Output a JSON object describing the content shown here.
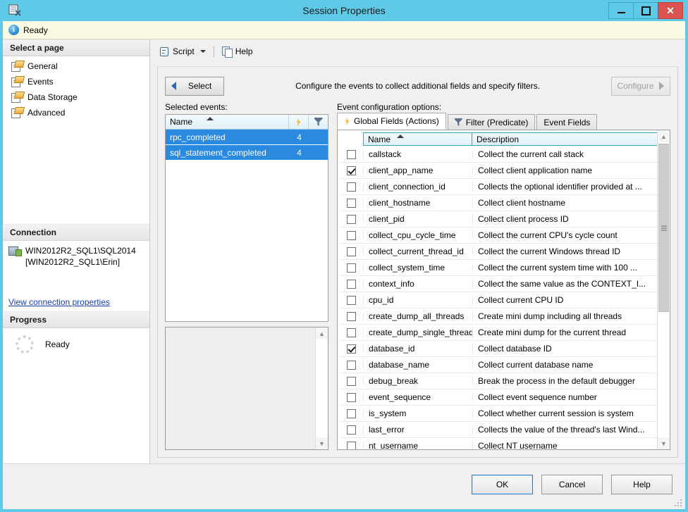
{
  "window": {
    "title": "Session Properties",
    "icon": "session-properties-icon",
    "minimize_label": "Minimize",
    "maximize_label": "Maximize",
    "close_label": "Close"
  },
  "status": {
    "icon": "info-icon",
    "text": "Ready"
  },
  "sidebar": {
    "header": "Select a page",
    "items": [
      {
        "label": "General",
        "icon": "page-icon"
      },
      {
        "label": "Events",
        "icon": "page-icon"
      },
      {
        "label": "Data Storage",
        "icon": "page-icon"
      },
      {
        "label": "Advanced",
        "icon": "page-icon"
      }
    ],
    "connection": {
      "header": "Connection",
      "icon": "server-icon",
      "server": "WIN2012R2_SQL1\\SQL2014",
      "user": "[WIN2012R2_SQL1\\Erin]",
      "link": "View connection properties"
    },
    "progress": {
      "header": "Progress",
      "icon": "spinner-icon",
      "text": "Ready"
    }
  },
  "toolbar": {
    "script_label": "Script",
    "script_icon": "script-icon",
    "script_dropdown_icon": "chevron-down-icon",
    "help_label": "Help",
    "help_icon": "help-icon"
  },
  "main": {
    "select_button": "Select",
    "select_arrow_icon": "arrow-left-icon",
    "hint": "Configure the events to collect additional fields and specify filters.",
    "configure_button": "Configure",
    "configure_arrow_icon": "arrow-right-icon",
    "configure_enabled": false,
    "selected_events_label": "Selected events:",
    "selected_events_grid": {
      "columns": [
        "Name",
        "actions-column",
        "filter-column"
      ],
      "name_header": "Name",
      "sort": "ascending",
      "action_icon": "lightning-bolt-icon",
      "filter_icon": "funnel-icon",
      "rows": [
        {
          "name": "rpc_completed",
          "actions": "4",
          "filter": "",
          "selected": true
        },
        {
          "name": "sql_statement_completed",
          "actions": "4",
          "filter": "",
          "selected": true
        }
      ]
    },
    "description_panel": {
      "text": ""
    },
    "event_config_label": "Event configuration options:",
    "tabs": [
      {
        "label": "Global Fields (Actions)",
        "icon": "lightning-bolt-icon",
        "active": true
      },
      {
        "label": "Filter (Predicate)",
        "icon": "funnel-icon",
        "active": false
      },
      {
        "label": "Event Fields",
        "icon": "",
        "active": false
      }
    ],
    "fields_table": {
      "headers": {
        "check": "",
        "name": "Name",
        "description": "Description"
      },
      "sort": "ascending",
      "rows": [
        {
          "checked": false,
          "name": "callstack",
          "description": "Collect the current call stack"
        },
        {
          "checked": true,
          "name": "client_app_name",
          "description": "Collect client application name"
        },
        {
          "checked": false,
          "name": "client_connection_id",
          "description": "Collects the optional identifier provided at ..."
        },
        {
          "checked": false,
          "name": "client_hostname",
          "description": "Collect client hostname"
        },
        {
          "checked": false,
          "name": "client_pid",
          "description": "Collect client process ID"
        },
        {
          "checked": false,
          "name": "collect_cpu_cycle_time",
          "description": "Collect the current CPU's cycle count"
        },
        {
          "checked": false,
          "name": "collect_current_thread_id",
          "description": "Collect the current Windows thread ID"
        },
        {
          "checked": false,
          "name": "collect_system_time",
          "description": "Collect the current system time with 100 ..."
        },
        {
          "checked": false,
          "name": "context_info",
          "description": "Collect the same value as the CONTEXT_I..."
        },
        {
          "checked": false,
          "name": "cpu_id",
          "description": "Collect current CPU ID"
        },
        {
          "checked": false,
          "name": "create_dump_all_threads",
          "description": "Create mini dump including all threads"
        },
        {
          "checked": false,
          "name": "create_dump_single_thread",
          "description": "Create mini dump for the current thread"
        },
        {
          "checked": true,
          "name": "database_id",
          "description": "Collect database ID"
        },
        {
          "checked": false,
          "name": "database_name",
          "description": "Collect current database name"
        },
        {
          "checked": false,
          "name": "debug_break",
          "description": "Break the process in the default debugger"
        },
        {
          "checked": false,
          "name": "event_sequence",
          "description": "Collect event sequence number"
        },
        {
          "checked": false,
          "name": "is_system",
          "description": "Collect whether current session is system"
        },
        {
          "checked": false,
          "name": "last_error",
          "description": "Collects the value of the thread's last Wind..."
        },
        {
          "checked": false,
          "name": "nt_username",
          "description": "Collect NT username"
        }
      ]
    }
  },
  "footer": {
    "ok": "OK",
    "cancel": "Cancel",
    "help": "Help"
  },
  "colors": {
    "titlebar": "#5fc9e8",
    "close_button": "#d9534f",
    "status_strip": "#fbfbe4",
    "selection": "#2a8ae0",
    "link": "#1a3fa8"
  }
}
